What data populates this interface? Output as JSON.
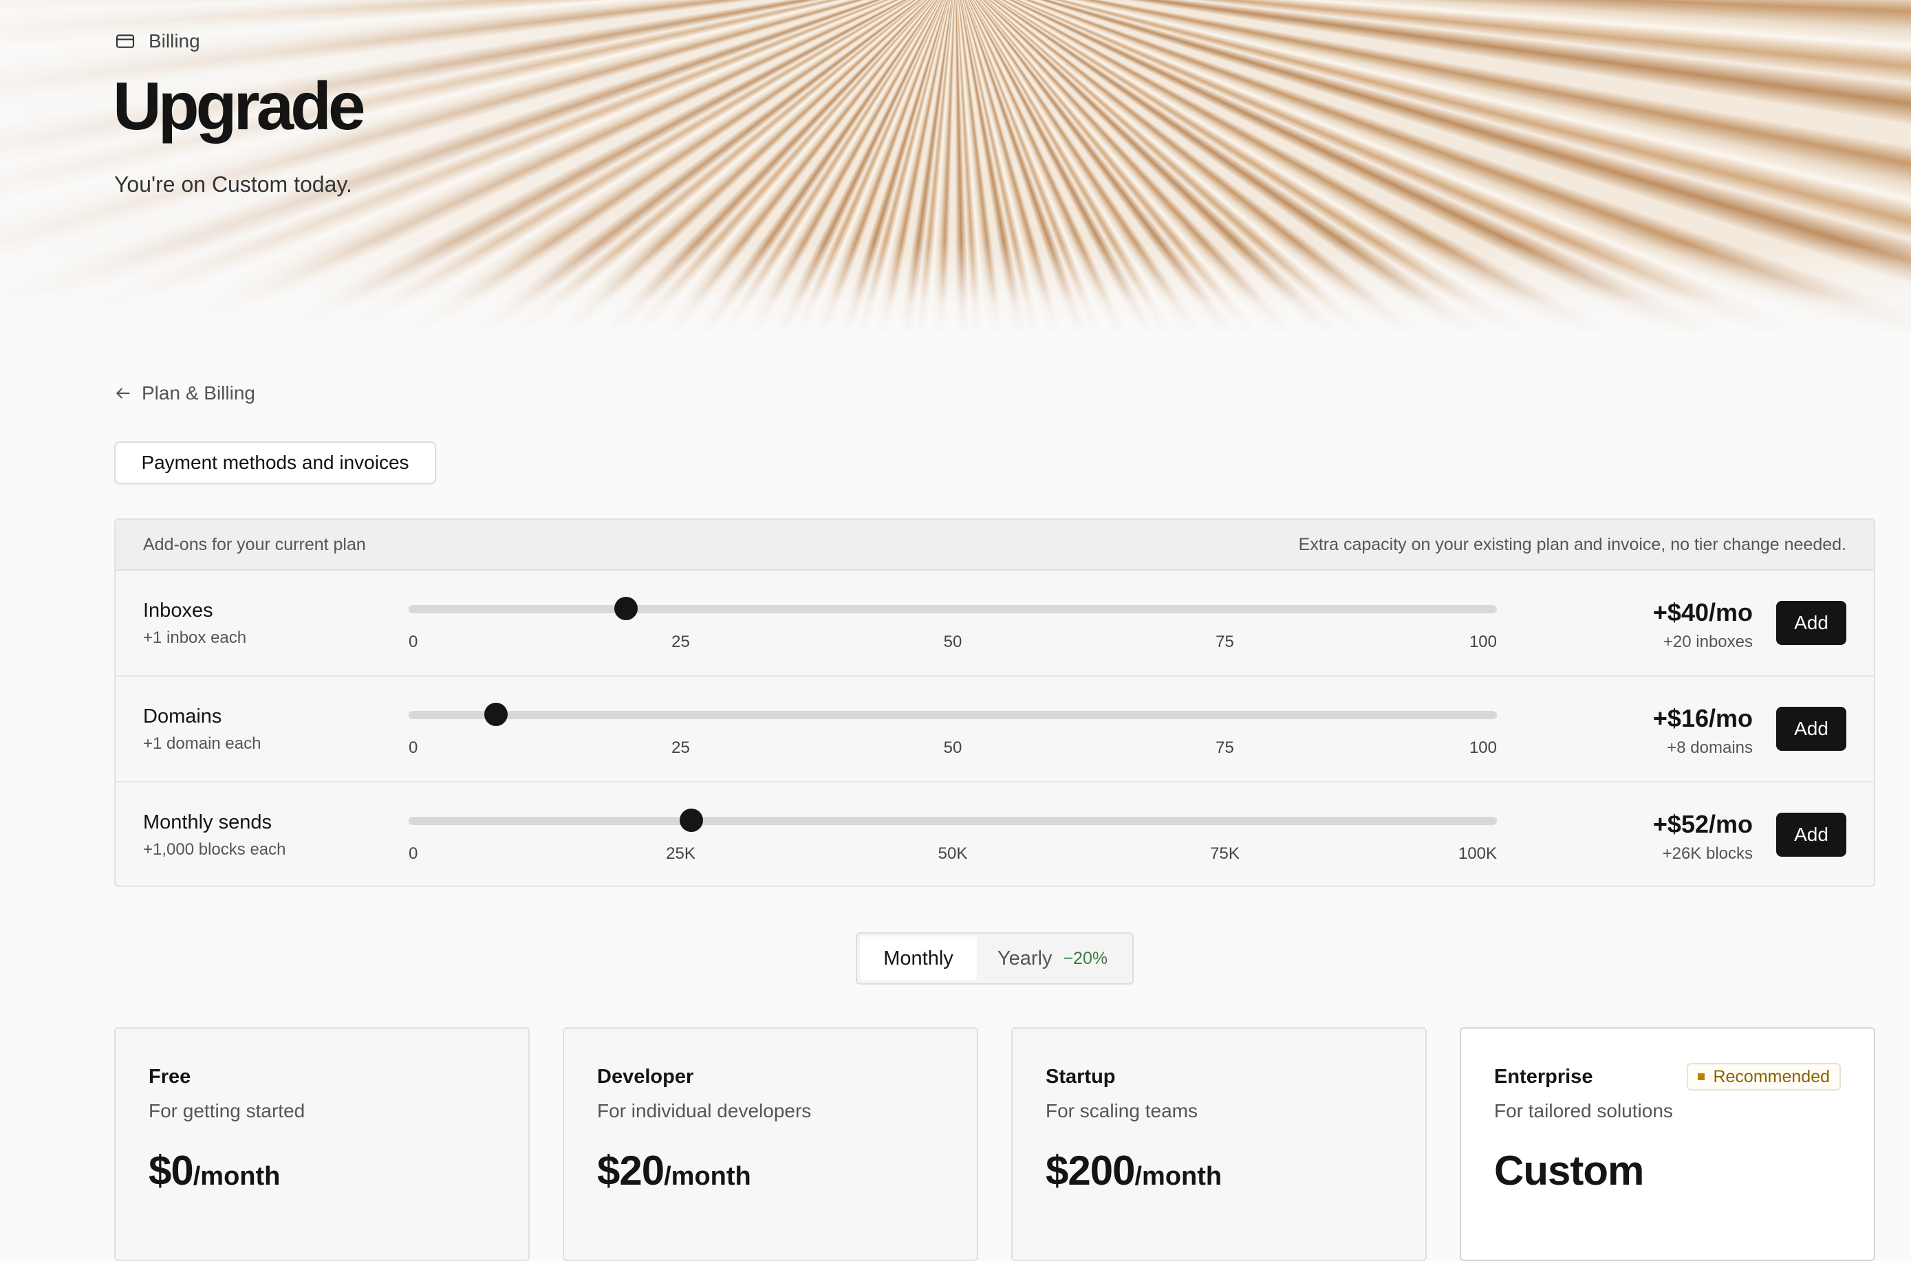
{
  "header": {
    "breadcrumb": "Billing",
    "title": "Upgrade",
    "subtitle": "You're on Custom today."
  },
  "nav": {
    "back_label": "Plan & Billing",
    "payment_button": "Payment methods and invoices"
  },
  "addons": {
    "header_left": "Add-ons for your current plan",
    "header_right": "Extra capacity on your existing plan and invoice, no tier change needed.",
    "add_label": "Add",
    "rows": [
      {
        "name": "Inboxes",
        "sub": "+1 inbox each",
        "min": 0,
        "max": 100,
        "value": 20,
        "ticks": [
          "0",
          "25",
          "50",
          "75",
          "100"
        ],
        "price": "+$40/mo",
        "price_sub": "+20 inboxes"
      },
      {
        "name": "Domains",
        "sub": "+1 domain each",
        "min": 0,
        "max": 100,
        "value": 8,
        "ticks": [
          "0",
          "25",
          "50",
          "75",
          "100"
        ],
        "price": "+$16/mo",
        "price_sub": "+8 domains"
      },
      {
        "name": "Monthly sends",
        "sub": "+1,000 blocks each",
        "min": 0,
        "max": 100,
        "value": 26,
        "ticks": [
          "0",
          "25K",
          "50K",
          "75K",
          "100K"
        ],
        "price": "+$52/mo",
        "price_sub": "+26K blocks"
      }
    ]
  },
  "billing_toggle": {
    "monthly": "Monthly",
    "yearly": "Yearly",
    "yearly_discount": "−20%",
    "selected": "monthly"
  },
  "plans": [
    {
      "name": "Free",
      "desc": "For getting started",
      "price": "$0",
      "per": "/month"
    },
    {
      "name": "Developer",
      "desc": "For individual developers",
      "price": "$20",
      "per": "/month"
    },
    {
      "name": "Startup",
      "desc": "For scaling teams",
      "price": "$200",
      "per": "/month"
    },
    {
      "name": "Enterprise",
      "desc": "For tailored solutions",
      "price": "Custom",
      "per": "",
      "badge": "Recommended"
    }
  ],
  "colors": {
    "accent_dark": "#141414",
    "discount_green": "#3c7d3e",
    "badge_gold": "#8a6300"
  },
  "icons": {
    "breadcrumb": "credit-card-icon",
    "back": "arrow-left-icon"
  }
}
